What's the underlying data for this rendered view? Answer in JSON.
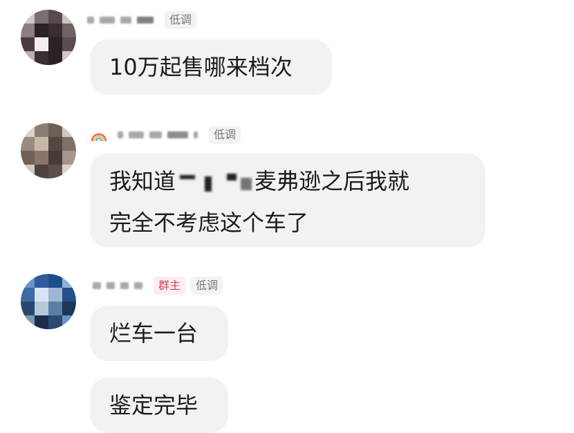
{
  "messages": [
    {
      "tags": [
        "低调"
      ],
      "text_lines": [
        "10万起售哪来档次"
      ]
    },
    {
      "tags": [
        "低调"
      ],
      "text_lines": [
        {
          "before": "我知道",
          "after": "麦弗逊之后我就"
        },
        "完全不考虑这个车了"
      ]
    },
    {
      "tags": [
        "群主",
        "低调"
      ],
      "text_lines": [
        "烂车一台"
      ]
    },
    {
      "tags": [],
      "text_lines": [
        "鉴定完毕"
      ]
    }
  ],
  "colors": {
    "bubble_bg": "#f2f2f3",
    "text": "#1b1b1b",
    "tag_bg": "#f3f3f3",
    "tag_text": "#777777",
    "owner_tag_bg": "#fbeef0",
    "owner_tag_text": "#d2455f"
  },
  "icons": [
    "rainbow-icon"
  ]
}
